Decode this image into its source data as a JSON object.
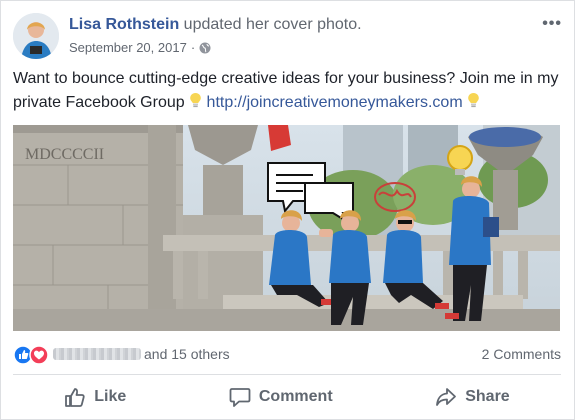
{
  "post": {
    "author": "Lisa Rothstein",
    "action": " updated her cover photo.",
    "date": "September 20, 2017",
    "date_separator": "·",
    "more_icon": "more-options-icon",
    "text_main": "Want to bounce cutting-edge creative ideas for your business? Join me in my private Facebook Group ",
    "link": "http://joincreativemoneymakers.com",
    "emoji": "light-bulb-icon"
  },
  "reactions": {
    "icons": [
      "like-reaction-icon",
      "love-reaction-icon"
    ],
    "others": "and 15 others",
    "comments": "2 Comments"
  },
  "actions": {
    "like": "Like",
    "comment": "Comment",
    "share": "Share"
  },
  "photo": {
    "inscription": "MDCCCCII"
  },
  "colors": {
    "brand_blue": "#365899",
    "like_blue": "#1877f2",
    "love_red": "#f33e58",
    "secondary_text": "#616770"
  }
}
